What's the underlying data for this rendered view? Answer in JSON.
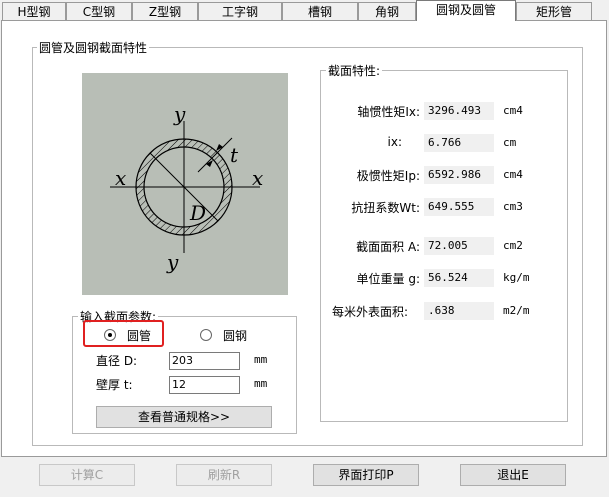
{
  "tabs": [
    "H型钢",
    "C型钢",
    "Z型钢",
    "工字钢",
    "槽钢",
    "角钢",
    "圆钢及圆管",
    "矩形管"
  ],
  "active_tab": "圆钢及圆管",
  "main_group_title": "圆管及圆钢截面特性",
  "diagram": {
    "labels": {
      "y_top": "y",
      "y_bottom": "y",
      "x_left": "x",
      "x_right": "x",
      "t": "t",
      "D": "D"
    }
  },
  "inputs": {
    "group_title": "输入截面参数:",
    "shape_options": [
      {
        "label": "圆管",
        "selected": true
      },
      {
        "label": "圆钢",
        "selected": false
      }
    ],
    "diameter": {
      "label": "直径 D:",
      "value": "203",
      "unit": "mm"
    },
    "thickness": {
      "label": "壁厚 t:",
      "value": "12",
      "unit": "mm"
    },
    "spec_button": "查看普通规格>>"
  },
  "properties": {
    "group_title": "截面特性:",
    "rows": [
      {
        "label": "轴惯性矩Ix:",
        "value": "3296.493",
        "unit": "cm4"
      },
      {
        "label": "ix:",
        "value": "6.766",
        "unit": "cm"
      },
      {
        "label": "极惯性矩Ip:",
        "value": "6592.986",
        "unit": "cm4"
      },
      {
        "label": "抗扭系数Wt:",
        "value": "649.555",
        "unit": "cm3"
      },
      {
        "label": "截面面积 A:",
        "value": "72.005",
        "unit": "cm2"
      },
      {
        "label": "单位重量 g:",
        "value": "56.524",
        "unit": "kg/m"
      },
      {
        "label": "每米外表面积:",
        "value": ".638",
        "unit": "m2/m"
      }
    ]
  },
  "buttons": {
    "calculate": {
      "label": "计算C",
      "enabled": false
    },
    "refresh": {
      "label": "刷新R",
      "enabled": false
    },
    "print": {
      "label": "界面打印P",
      "enabled": true
    },
    "exit": {
      "label": "退出E",
      "enabled": true
    }
  },
  "colors": {
    "diagram_bg": "#b8beb6",
    "highlight": "#e02020"
  }
}
